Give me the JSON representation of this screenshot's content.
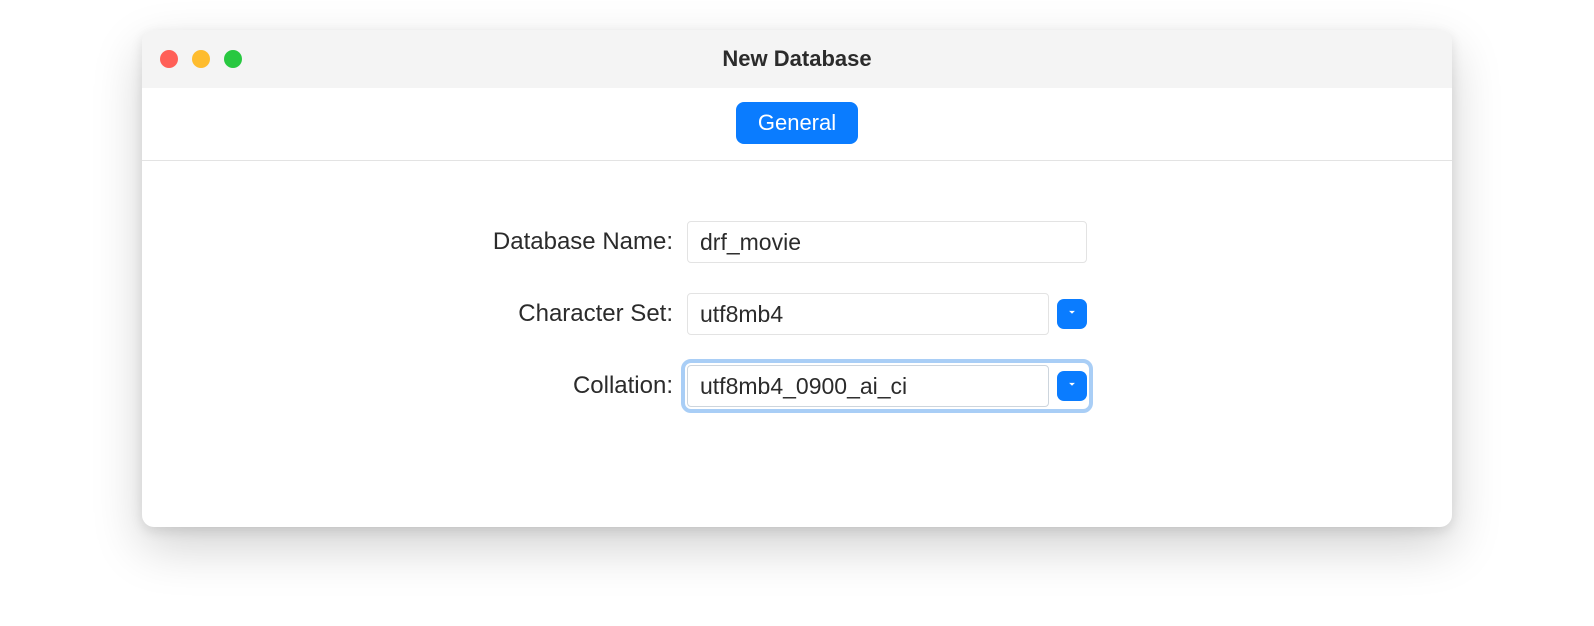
{
  "window": {
    "title": "New Database"
  },
  "tabs": {
    "general": "General"
  },
  "form": {
    "database_name": {
      "label": "Database Name:",
      "value": "drf_movie"
    },
    "character_set": {
      "label": "Character Set:",
      "value": "utf8mb4"
    },
    "collation": {
      "label": "Collation:",
      "value": "utf8mb4_0900_ai_ci"
    }
  }
}
